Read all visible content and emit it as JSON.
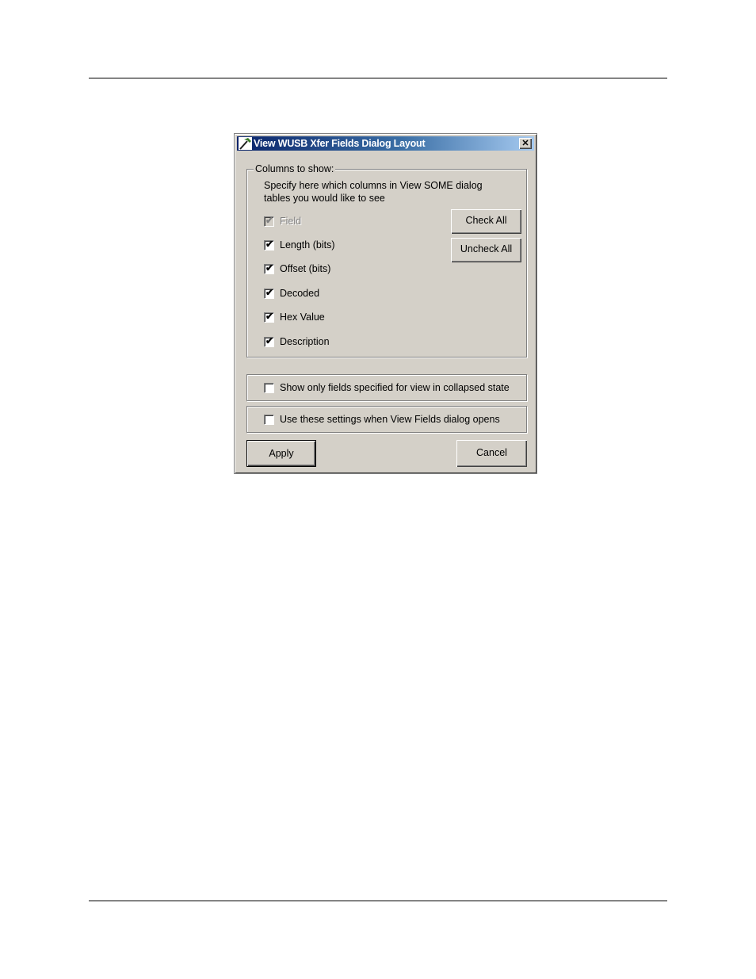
{
  "dialog": {
    "title": "View WUSB Xfer Fields Dialog Layout",
    "title_icon": "hammer-icon",
    "close_icon": "close-icon",
    "close_label": "✕",
    "columns_group": {
      "label": "Columns to show:",
      "description": "Specify here which columns in View SOME dialog tables you would like to see",
      "columns": [
        {
          "label": "Field",
          "checked": true,
          "disabled": true
        },
        {
          "label": "Length (bits)",
          "checked": true,
          "disabled": false
        },
        {
          "label": "Offset (bits)",
          "checked": true,
          "disabled": false
        },
        {
          "label": "Decoded",
          "checked": true,
          "disabled": false
        },
        {
          "label": "Hex Value",
          "checked": true,
          "disabled": false
        },
        {
          "label": "Description",
          "checked": true,
          "disabled": false
        }
      ],
      "check_all_label": "Check All",
      "uncheck_all_label": "Uncheck All"
    },
    "options": [
      {
        "label": "Show only fields specified for view in collapsed state",
        "checked": false
      },
      {
        "label": "Use these settings when View Fields dialog opens",
        "checked": false
      }
    ],
    "apply_label": "Apply",
    "cancel_label": "Cancel",
    "check_mark": "✔"
  }
}
